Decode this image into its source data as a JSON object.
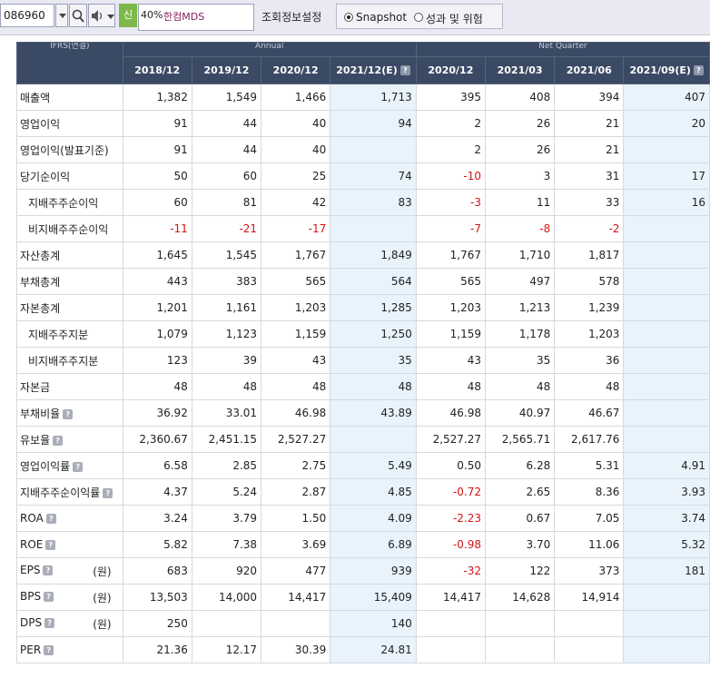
{
  "toolbar": {
    "code_value": "086960",
    "new_badge": "신",
    "pct_label": "40%",
    "company_name": "한컴MDS",
    "settings_label": "조회정보설정",
    "radio_snapshot": "Snapshot",
    "radio_risk": "성과 및 위험",
    "selected": "Snapshot"
  },
  "table": {
    "corner_label": "IFRS(연결)",
    "group_annual": "Annual",
    "group_quarter": "Net Quarter",
    "columns": [
      "2018/12",
      "2019/12",
      "2020/12",
      "2021/12(E)",
      "2020/12",
      "2021/03",
      "2021/06",
      "2021/09(E)"
    ],
    "help_icon": "?",
    "rows": [
      {
        "label": "매출액",
        "indent": false,
        "help": false,
        "unit": "",
        "values": [
          "1,382",
          "1,549",
          "1,466",
          "1,713",
          "395",
          "408",
          "394",
          "407"
        ]
      },
      {
        "label": "영업이익",
        "indent": false,
        "help": false,
        "unit": "",
        "values": [
          "91",
          "44",
          "40",
          "94",
          "2",
          "26",
          "21",
          "20"
        ]
      },
      {
        "label": "영업이익(발표기준)",
        "indent": false,
        "help": false,
        "unit": "",
        "values": [
          "91",
          "44",
          "40",
          "",
          "2",
          "26",
          "21",
          ""
        ]
      },
      {
        "label": "당기순이익",
        "indent": false,
        "help": false,
        "unit": "",
        "values": [
          "50",
          "60",
          "25",
          "74",
          "-10",
          "3",
          "31",
          "17"
        ]
      },
      {
        "label": "지배주주순이익",
        "indent": true,
        "help": false,
        "unit": "",
        "values": [
          "60",
          "81",
          "42",
          "83",
          "-3",
          "11",
          "33",
          "16"
        ]
      },
      {
        "label": "비지배주주순이익",
        "indent": true,
        "help": false,
        "unit": "",
        "values": [
          "-11",
          "-21",
          "-17",
          "",
          "-7",
          "-8",
          "-2",
          ""
        ]
      },
      {
        "label": "자산총계",
        "indent": false,
        "help": false,
        "unit": "",
        "values": [
          "1,645",
          "1,545",
          "1,767",
          "1,849",
          "1,767",
          "1,710",
          "1,817",
          ""
        ]
      },
      {
        "label": "부채총계",
        "indent": false,
        "help": false,
        "unit": "",
        "values": [
          "443",
          "383",
          "565",
          "564",
          "565",
          "497",
          "578",
          ""
        ]
      },
      {
        "label": "자본총계",
        "indent": false,
        "help": false,
        "unit": "",
        "values": [
          "1,201",
          "1,161",
          "1,203",
          "1,285",
          "1,203",
          "1,213",
          "1,239",
          ""
        ]
      },
      {
        "label": "지배주주지분",
        "indent": true,
        "help": false,
        "unit": "",
        "values": [
          "1,079",
          "1,123",
          "1,159",
          "1,250",
          "1,159",
          "1,178",
          "1,203",
          ""
        ]
      },
      {
        "label": "비지배주주지분",
        "indent": true,
        "help": false,
        "unit": "",
        "values": [
          "123",
          "39",
          "43",
          "35",
          "43",
          "35",
          "36",
          ""
        ]
      },
      {
        "label": "자본금",
        "indent": false,
        "help": false,
        "unit": "",
        "values": [
          "48",
          "48",
          "48",
          "48",
          "48",
          "48",
          "48",
          ""
        ]
      },
      {
        "label": "부채비율",
        "indent": false,
        "help": true,
        "unit": "",
        "values": [
          "36.92",
          "33.01",
          "46.98",
          "43.89",
          "46.98",
          "40.97",
          "46.67",
          ""
        ]
      },
      {
        "label": "유보율",
        "indent": false,
        "help": true,
        "unit": "",
        "values": [
          "2,360.67",
          "2,451.15",
          "2,527.27",
          "",
          "2,527.27",
          "2,565.71",
          "2,617.76",
          ""
        ]
      },
      {
        "label": "영업이익률",
        "indent": false,
        "help": true,
        "unit": "",
        "values": [
          "6.58",
          "2.85",
          "2.75",
          "5.49",
          "0.50",
          "6.28",
          "5.31",
          "4.91"
        ]
      },
      {
        "label": "지배주주순이익률",
        "indent": false,
        "help": true,
        "unit": "",
        "values": [
          "4.37",
          "5.24",
          "2.87",
          "4.85",
          "-0.72",
          "2.65",
          "8.36",
          "3.93"
        ]
      },
      {
        "label": "ROA",
        "indent": false,
        "help": true,
        "unit": "",
        "values": [
          "3.24",
          "3.79",
          "1.50",
          "4.09",
          "-2.23",
          "0.67",
          "7.05",
          "3.74"
        ]
      },
      {
        "label": "ROE",
        "indent": false,
        "help": true,
        "unit": "",
        "values": [
          "5.82",
          "7.38",
          "3.69",
          "6.89",
          "-0.98",
          "3.70",
          "11.06",
          "5.32"
        ]
      },
      {
        "label": "EPS",
        "indent": false,
        "help": true,
        "unit": "(원)",
        "values": [
          "683",
          "920",
          "477",
          "939",
          "-32",
          "122",
          "373",
          "181"
        ]
      },
      {
        "label": "BPS",
        "indent": false,
        "help": true,
        "unit": "(원)",
        "values": [
          "13,503",
          "14,000",
          "14,417",
          "15,409",
          "14,417",
          "14,628",
          "14,914",
          ""
        ]
      },
      {
        "label": "DPS",
        "indent": false,
        "help": true,
        "unit": "(원)",
        "values": [
          "250",
          "",
          "",
          "140",
          "",
          "",
          "",
          ""
        ]
      },
      {
        "label": "PER",
        "indent": false,
        "help": true,
        "unit": "",
        "values": [
          "21.36",
          "12.17",
          "30.39",
          "24.81",
          "",
          "",
          "",
          ""
        ]
      }
    ]
  }
}
